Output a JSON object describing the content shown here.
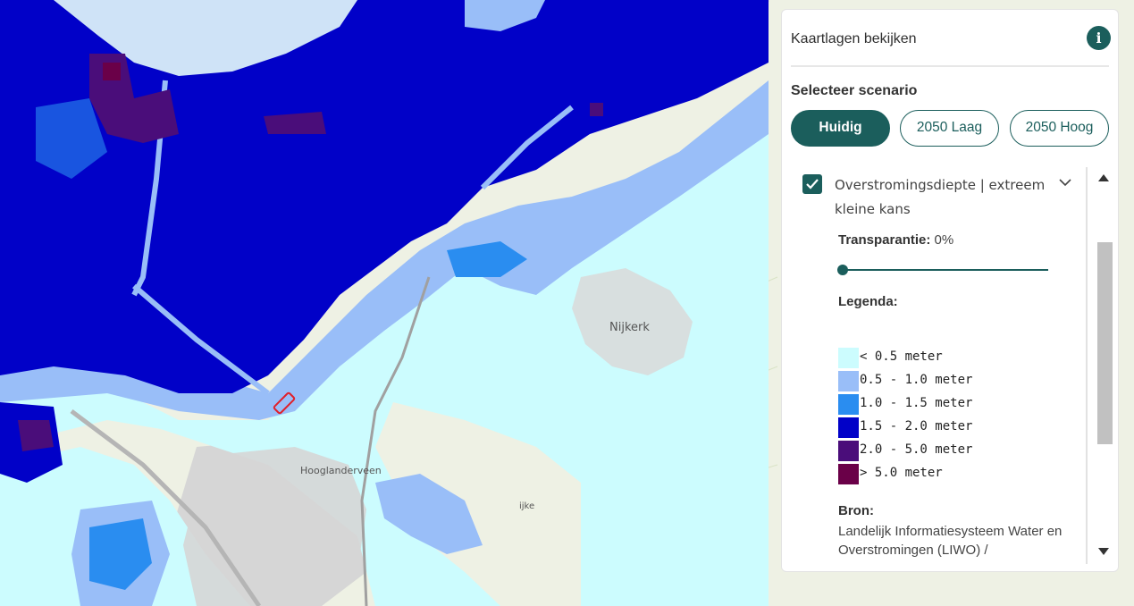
{
  "map": {
    "labels": [
      "Nijkerk",
      "Hooglanderveen",
      "ijke"
    ],
    "colors": {
      "base": "#eef1e4",
      "urban": "#d6d6d6",
      "water_river": "#cfe3f7",
      "depth_lt_0_5": "#ccfcfe",
      "depth_0_5_1_0": "#99bef8",
      "depth_1_0_1_5": "#2a8df0",
      "depth_1_5_2_0": "#0101c8",
      "depth_2_0_5_0": "#4a0d7a",
      "depth_gt_5_0": "#6a0048",
      "marker": "#e0202a"
    }
  },
  "panel": {
    "title": "Kaartlagen bekijken",
    "info_icon": "info-icon",
    "scenario_title": "Selecteer scenario",
    "scenarios": [
      {
        "label": "Huidig",
        "active": true
      },
      {
        "label": "2050 Laag",
        "active": false
      },
      {
        "label": "2050 Hoog",
        "active": false
      }
    ],
    "layer": {
      "checked": true,
      "name": "Overstromingsdiepte | extreem kleine kans",
      "transparency_label": "Transparantie:",
      "transparency_value": "0%",
      "transparency_fraction": 0,
      "legend_title": "Legenda:",
      "legend": [
        {
          "label": "< 0.5 meter",
          "color": "#ccfcfe"
        },
        {
          "label": "0.5 - 1.0 meter",
          "color": "#99bef8"
        },
        {
          "label": "1.0 - 1.5 meter",
          "color": "#2a8df0"
        },
        {
          "label": "1.5 - 2.0 meter",
          "color": "#0101c8"
        },
        {
          "label": "2.0 - 5.0 meter",
          "color": "#4a0d7a"
        },
        {
          "label": "> 5.0 meter",
          "color": "#6a0048"
        }
      ],
      "source_title": "Bron:",
      "source_text": "Landelijk Informatiesysteem Water en Overstromingen (LIWO) /"
    }
  }
}
